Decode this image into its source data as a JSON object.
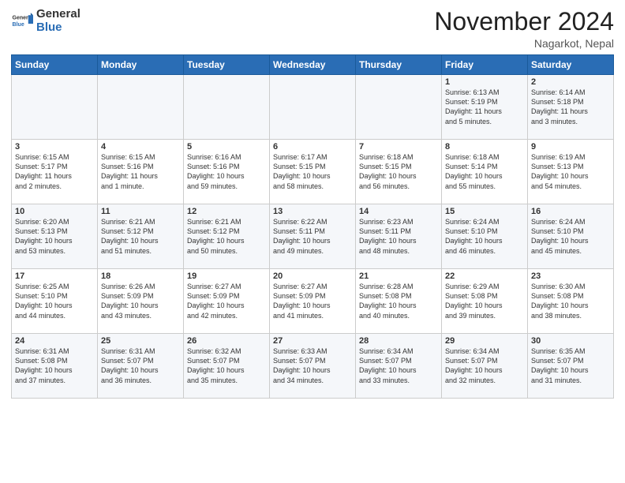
{
  "header": {
    "logo_general": "General",
    "logo_blue": "Blue",
    "month_title": "November 2024",
    "location": "Nagarkot, Nepal"
  },
  "days_of_week": [
    "Sunday",
    "Monday",
    "Tuesday",
    "Wednesday",
    "Thursday",
    "Friday",
    "Saturday"
  ],
  "weeks": [
    [
      {
        "day": "",
        "info": ""
      },
      {
        "day": "",
        "info": ""
      },
      {
        "day": "",
        "info": ""
      },
      {
        "day": "",
        "info": ""
      },
      {
        "day": "",
        "info": ""
      },
      {
        "day": "1",
        "info": "Sunrise: 6:13 AM\nSunset: 5:19 PM\nDaylight: 11 hours\nand 5 minutes."
      },
      {
        "day": "2",
        "info": "Sunrise: 6:14 AM\nSunset: 5:18 PM\nDaylight: 11 hours\nand 3 minutes."
      }
    ],
    [
      {
        "day": "3",
        "info": "Sunrise: 6:15 AM\nSunset: 5:17 PM\nDaylight: 11 hours\nand 2 minutes."
      },
      {
        "day": "4",
        "info": "Sunrise: 6:15 AM\nSunset: 5:16 PM\nDaylight: 11 hours\nand 1 minute."
      },
      {
        "day": "5",
        "info": "Sunrise: 6:16 AM\nSunset: 5:16 PM\nDaylight: 10 hours\nand 59 minutes."
      },
      {
        "day": "6",
        "info": "Sunrise: 6:17 AM\nSunset: 5:15 PM\nDaylight: 10 hours\nand 58 minutes."
      },
      {
        "day": "7",
        "info": "Sunrise: 6:18 AM\nSunset: 5:15 PM\nDaylight: 10 hours\nand 56 minutes."
      },
      {
        "day": "8",
        "info": "Sunrise: 6:18 AM\nSunset: 5:14 PM\nDaylight: 10 hours\nand 55 minutes."
      },
      {
        "day": "9",
        "info": "Sunrise: 6:19 AM\nSunset: 5:13 PM\nDaylight: 10 hours\nand 54 minutes."
      }
    ],
    [
      {
        "day": "10",
        "info": "Sunrise: 6:20 AM\nSunset: 5:13 PM\nDaylight: 10 hours\nand 53 minutes."
      },
      {
        "day": "11",
        "info": "Sunrise: 6:21 AM\nSunset: 5:12 PM\nDaylight: 10 hours\nand 51 minutes."
      },
      {
        "day": "12",
        "info": "Sunrise: 6:21 AM\nSunset: 5:12 PM\nDaylight: 10 hours\nand 50 minutes."
      },
      {
        "day": "13",
        "info": "Sunrise: 6:22 AM\nSunset: 5:11 PM\nDaylight: 10 hours\nand 49 minutes."
      },
      {
        "day": "14",
        "info": "Sunrise: 6:23 AM\nSunset: 5:11 PM\nDaylight: 10 hours\nand 48 minutes."
      },
      {
        "day": "15",
        "info": "Sunrise: 6:24 AM\nSunset: 5:10 PM\nDaylight: 10 hours\nand 46 minutes."
      },
      {
        "day": "16",
        "info": "Sunrise: 6:24 AM\nSunset: 5:10 PM\nDaylight: 10 hours\nand 45 minutes."
      }
    ],
    [
      {
        "day": "17",
        "info": "Sunrise: 6:25 AM\nSunset: 5:10 PM\nDaylight: 10 hours\nand 44 minutes."
      },
      {
        "day": "18",
        "info": "Sunrise: 6:26 AM\nSunset: 5:09 PM\nDaylight: 10 hours\nand 43 minutes."
      },
      {
        "day": "19",
        "info": "Sunrise: 6:27 AM\nSunset: 5:09 PM\nDaylight: 10 hours\nand 42 minutes."
      },
      {
        "day": "20",
        "info": "Sunrise: 6:27 AM\nSunset: 5:09 PM\nDaylight: 10 hours\nand 41 minutes."
      },
      {
        "day": "21",
        "info": "Sunrise: 6:28 AM\nSunset: 5:08 PM\nDaylight: 10 hours\nand 40 minutes."
      },
      {
        "day": "22",
        "info": "Sunrise: 6:29 AM\nSunset: 5:08 PM\nDaylight: 10 hours\nand 39 minutes."
      },
      {
        "day": "23",
        "info": "Sunrise: 6:30 AM\nSunset: 5:08 PM\nDaylight: 10 hours\nand 38 minutes."
      }
    ],
    [
      {
        "day": "24",
        "info": "Sunrise: 6:31 AM\nSunset: 5:08 PM\nDaylight: 10 hours\nand 37 minutes."
      },
      {
        "day": "25",
        "info": "Sunrise: 6:31 AM\nSunset: 5:07 PM\nDaylight: 10 hours\nand 36 minutes."
      },
      {
        "day": "26",
        "info": "Sunrise: 6:32 AM\nSunset: 5:07 PM\nDaylight: 10 hours\nand 35 minutes."
      },
      {
        "day": "27",
        "info": "Sunrise: 6:33 AM\nSunset: 5:07 PM\nDaylight: 10 hours\nand 34 minutes."
      },
      {
        "day": "28",
        "info": "Sunrise: 6:34 AM\nSunset: 5:07 PM\nDaylight: 10 hours\nand 33 minutes."
      },
      {
        "day": "29",
        "info": "Sunrise: 6:34 AM\nSunset: 5:07 PM\nDaylight: 10 hours\nand 32 minutes."
      },
      {
        "day": "30",
        "info": "Sunrise: 6:35 AM\nSunset: 5:07 PM\nDaylight: 10 hours\nand 31 minutes."
      }
    ]
  ]
}
